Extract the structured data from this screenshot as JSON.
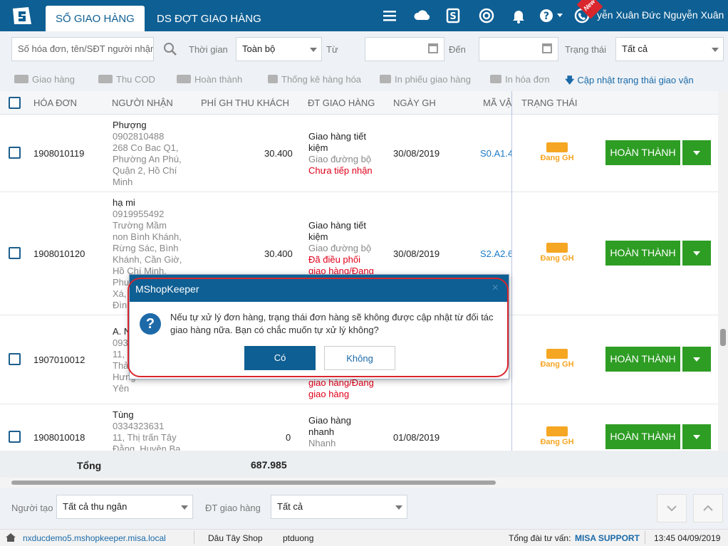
{
  "tabs": [
    {
      "label": "SỔ GIAO HÀNG"
    },
    {
      "label": "DS ĐỢT GIAO HÀNG"
    }
  ],
  "header": {
    "user_name": "yễn Xuân Đức Nguyễn Xuân",
    "new_badge": "New",
    "icons": [
      "menu-icon",
      "cloud-sync-icon",
      "s-icon",
      "spiral-icon",
      "bell-icon",
      "help-icon",
      "phone-icon"
    ]
  },
  "filters": {
    "search_placeholder": "Số hóa đơn, tên/SĐT người nhận",
    "time_label": "Thời gian",
    "time_value": "Toàn bộ",
    "from_label": "Từ",
    "to_label": "Đến",
    "status_label": "Trạng thái",
    "status_value": "Tất cả"
  },
  "toolbar": {
    "giao_hang": "Giao hàng",
    "thu_cod": "Thu COD",
    "hoan_thanh": "Hoàn thành",
    "thong_ke": "Thống kê hàng hóa",
    "in_phieu": "In phiếu giao hàng",
    "in_hoa_don": "In hóa đơn",
    "cap_nhat": "Cập nhật trạng thái giao vận"
  },
  "table": {
    "columns": [
      "HÓA ĐƠN",
      "NGƯỜI NHẬN",
      "PHÍ GH THU KHÁCH",
      "ĐT GIAO HÀNG",
      "NGÀY GH",
      "MÃ VẬ",
      "TRẠNG THÁI"
    ],
    "rows": [
      {
        "invoice": "1908010119",
        "recipient": [
          "Phượng",
          "0902810488",
          "268 Co Bac Q1,",
          "Phường An Phú,",
          "Quận 2, Hồ Chí",
          "Minh"
        ],
        "fee": "30.400",
        "partner": [
          "Giao hàng tiết",
          "kiệm"
        ],
        "method": "Giao đường bộ",
        "partner_status": [
          "Chưa tiếp nhận"
        ],
        "date": "30/08/2019",
        "code": "S0.A1.4",
        "status": "Đang GH",
        "action": "HOÀN THÀNH"
      },
      {
        "invoice": "1908010120",
        "recipient": [
          "hạ mi",
          "0919955492",
          "Trường Mầm",
          "non Bình Khánh,",
          "Rừng Sác, Bình",
          "Khánh, Cần Giờ,",
          "Hồ Chí Minh,",
          "Phư",
          "Xá,",
          "Đình"
        ],
        "fee": "30.400",
        "partner": [
          "Giao hàng tiết",
          "kiệm"
        ],
        "method": "Giao đường bộ",
        "partner_status": [
          "Đã điều phối",
          "giao hàng/Đang"
        ],
        "date": "30/08/2019",
        "code": "S2.A2.6",
        "status": "Đang GH",
        "action": "HOÀN THÀNH"
      },
      {
        "invoice": "1907010012",
        "recipient": [
          "A. N",
          "093",
          "11, ",
          "Thả",
          "Hưng",
          "Yên"
        ],
        "fee": "",
        "partner": [],
        "method": "",
        "partner_status": [
          "giao hàng/Đang",
          "giao hàng"
        ],
        "date": "",
        "code": "",
        "status": "Đang GH",
        "action": "HOÀN THÀNH"
      },
      {
        "invoice": "1908010018",
        "recipient": [
          "Tùng",
          "0334323631",
          "11, Thị trấn Tây",
          "Đằng, Huyện Ba"
        ],
        "fee": "0",
        "partner": [
          "Giao hàng",
          "nhanh"
        ],
        "method": "Nhanh",
        "partner_status": [],
        "date": "01/08/2019",
        "code": "",
        "status": "Đang GH",
        "action": "HOÀN THÀNH"
      }
    ]
  },
  "footer": {
    "total_label": "Tổng",
    "total_value": "687.985"
  },
  "bottom": {
    "creator_label": "Người tạo",
    "creator_value": "Tất cả thu ngân",
    "partner_label": "ĐT giao hàng",
    "partner_value": "Tất cả"
  },
  "statusbar": {
    "domain": "nxducdemo5.mshopkeeper.misa.local",
    "shop": "Dâu Tây Shop",
    "user": "ptduong",
    "hotline_label": "Tổng đài tư vấn:",
    "hotline_value": "MISA SUPPORT",
    "datetime": "13:45 04/09/2019"
  },
  "modal": {
    "title": "MShopKeeper",
    "message": "Nếu tự xử lý đơn hàng, trạng thái đơn hàng sẽ không được cập nhật từ đối tác giao hàng nữa. Bạn có chắc muốn tự xử lý không?",
    "yes": "Có",
    "no": "Không",
    "close": "×"
  }
}
